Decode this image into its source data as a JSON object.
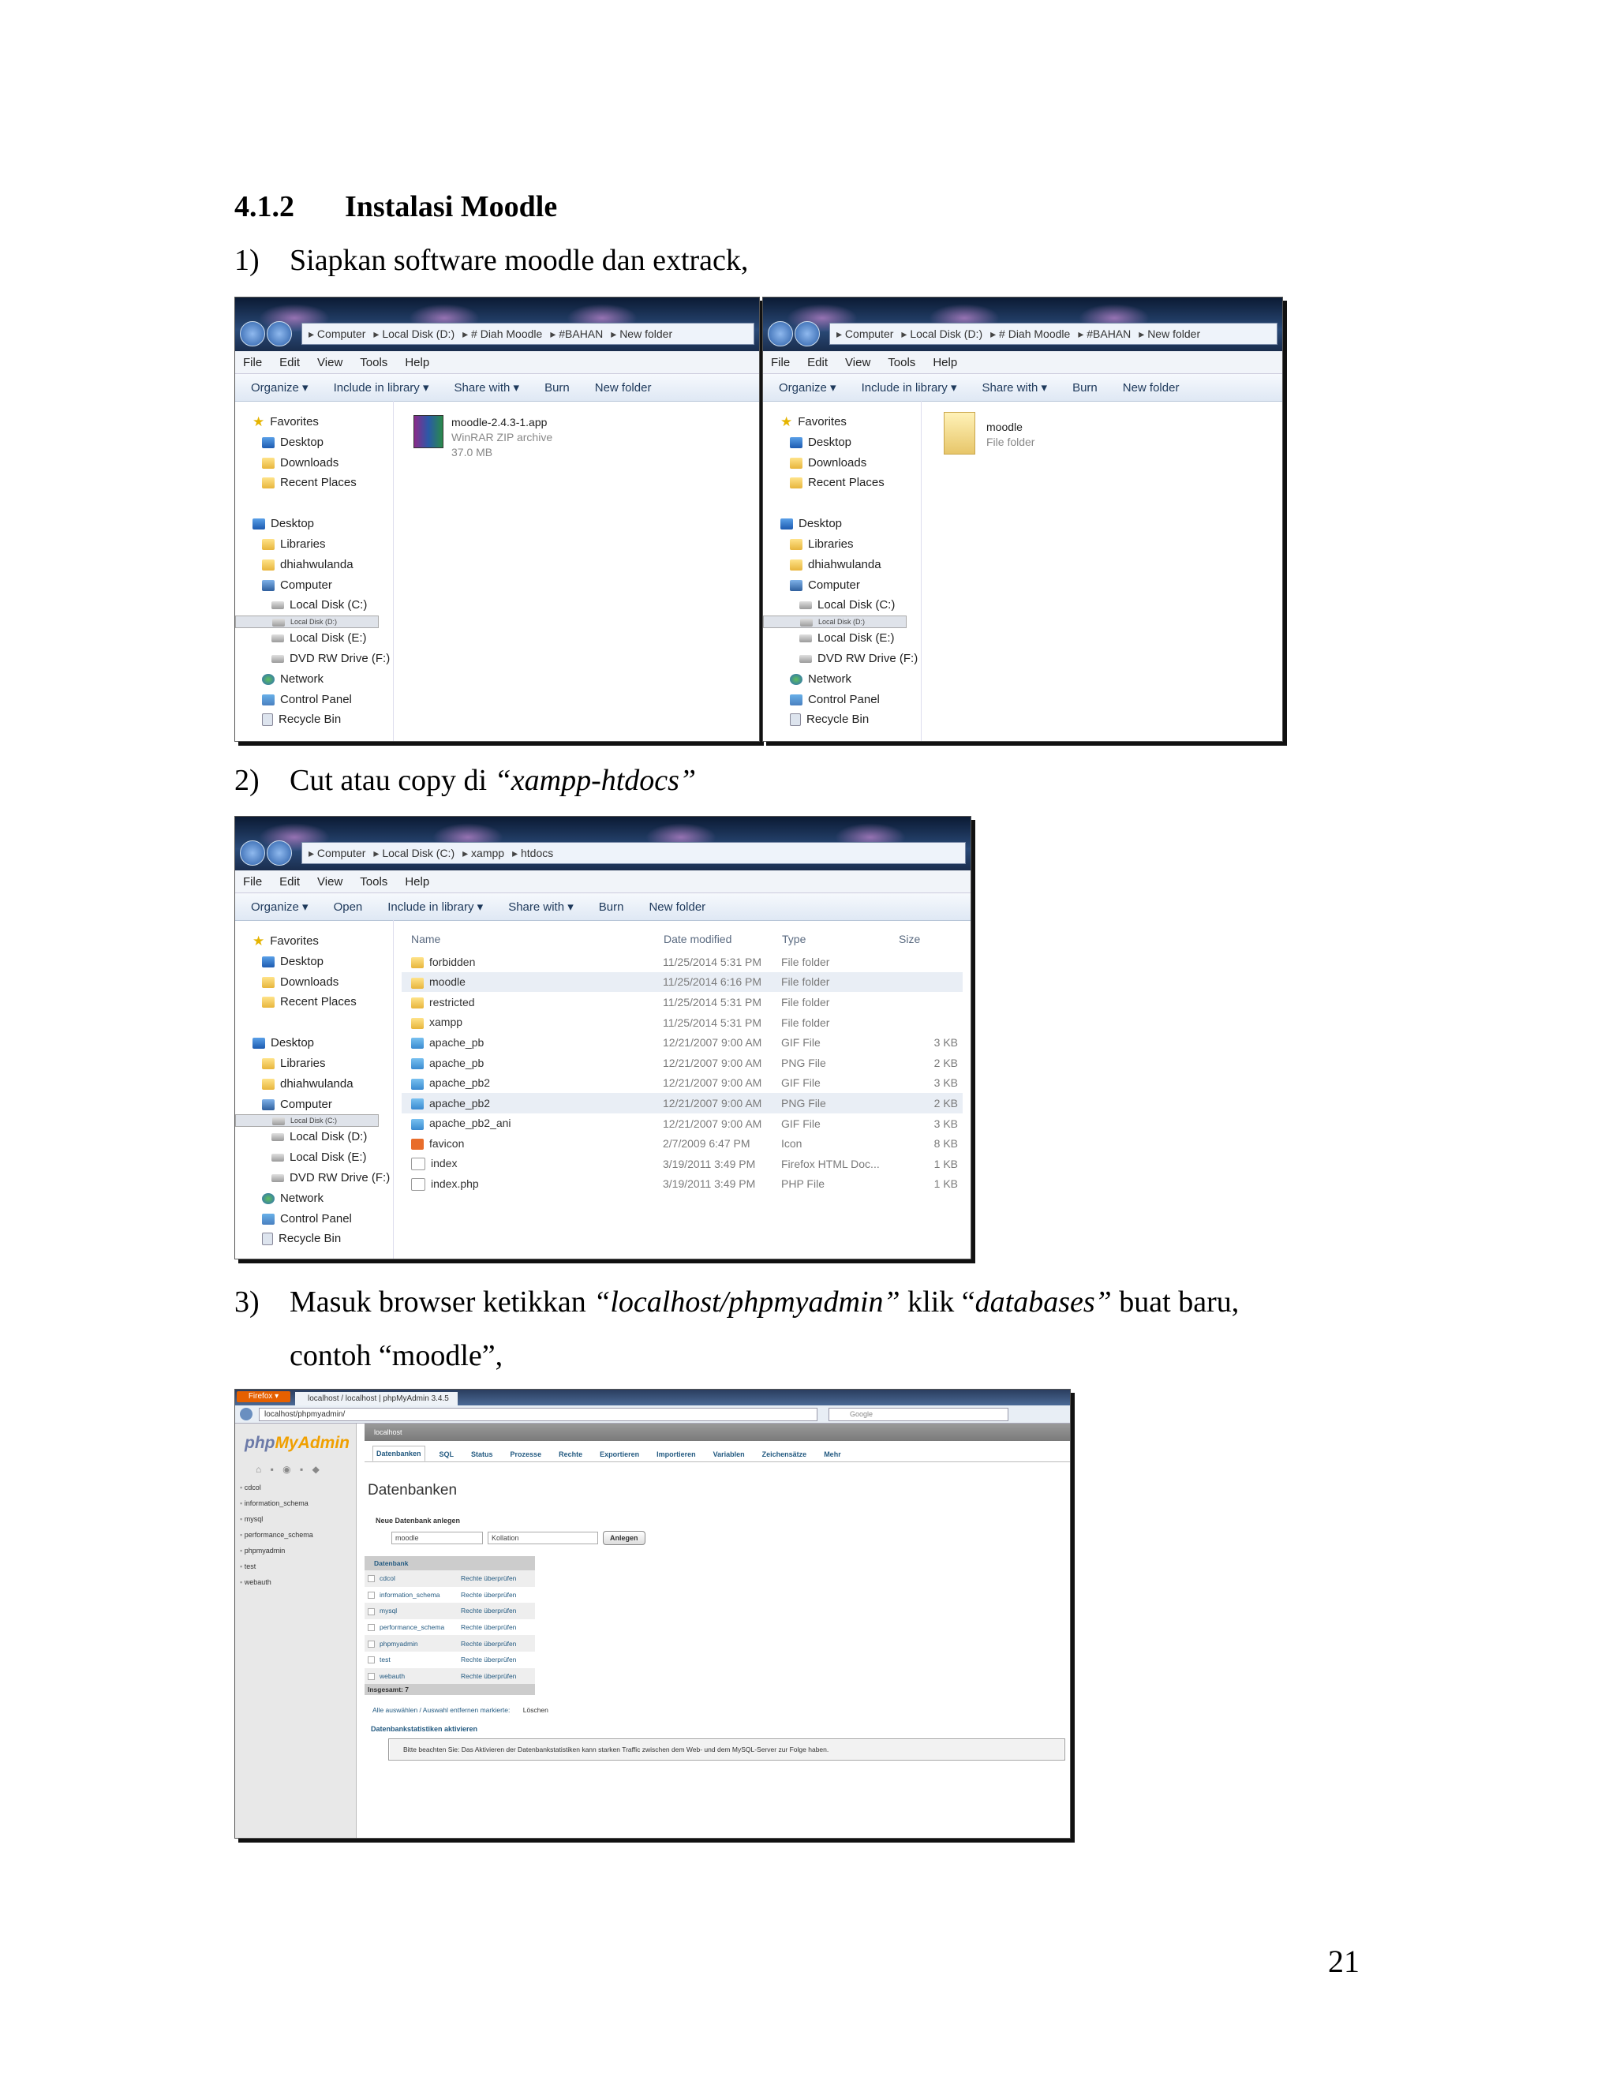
{
  "heading": {
    "number": "4.1.2",
    "title": "Instalasi Moodle"
  },
  "step1": {
    "num": "1)",
    "text": "Siapkan software moodle dan extrack,"
  },
  "step2": {
    "num": "2)",
    "text": "Cut atau copy di ",
    "italic": "“xampp-htdocs”"
  },
  "step3": {
    "num": "3)",
    "text_a": "Masuk browser ketikkan ",
    "italic_a": "“localhost/phpmyadmin”",
    "text_b": " klik “",
    "italic_b": "databases”",
    "text_c": " buat baru,",
    "line2": "contoh “moodle”,"
  },
  "page_number": "21",
  "explorer_common": {
    "menu": [
      "File",
      "Edit",
      "View",
      "Tools",
      "Help"
    ],
    "toolbar": [
      "Organize ▾",
      "Include in library ▾",
      "Share with ▾",
      "Burn",
      "New folder"
    ],
    "toolbar_htdocs": [
      "Organize ▾",
      "Open",
      "Include in library ▾",
      "Share with ▾",
      "Burn",
      "New folder"
    ],
    "tree": {
      "favorites": "Favorites",
      "desktop": "Desktop",
      "downloads": "Downloads",
      "recent": "Recent Places",
      "desktop2": "Desktop",
      "libraries": "Libraries",
      "user": "dhiahwulanda",
      "computer": "Computer",
      "c": "Local Disk (C:)",
      "d": "Local Disk (D:)",
      "e": "Local Disk (E:)",
      "f": "DVD RW Drive (F:)",
      "network": "Network",
      "control": "Control Panel",
      "recycle": "Recycle Bin"
    }
  },
  "win1": {
    "crumbs": [
      "Computer",
      "Local Disk (D:)",
      "# Diah Moodle",
      "#BAHAN",
      "New folder"
    ],
    "file": {
      "name": "moodle-2.4.3-1.app",
      "type": "WinRAR ZIP archive",
      "size": "37.0 MB"
    }
  },
  "win2": {
    "crumbs": [
      "Computer",
      "Local Disk (D:)",
      "# Diah Moodle",
      "#BAHAN",
      "New folder"
    ],
    "file": {
      "name": "moodle",
      "type": "File folder"
    }
  },
  "win3": {
    "crumbs": [
      "Computer",
      "Local Disk (C:)",
      "xampp",
      "htdocs"
    ],
    "columns": [
      "Name",
      "Date modified",
      "Type",
      "Size"
    ],
    "rows": [
      {
        "name": "forbidden",
        "date": "11/25/2014 5:31 PM",
        "type": "File folder",
        "size": "",
        "icon": "folder"
      },
      {
        "name": "moodle",
        "date": "11/25/2014 6:16 PM",
        "type": "File folder",
        "size": "",
        "icon": "folder"
      },
      {
        "name": "restricted",
        "date": "11/25/2014 5:31 PM",
        "type": "File folder",
        "size": "",
        "icon": "folder"
      },
      {
        "name": "xampp",
        "date": "11/25/2014 5:31 PM",
        "type": "File folder",
        "size": "",
        "icon": "folder"
      },
      {
        "name": "apache_pb",
        "date": "12/21/2007 9:00 AM",
        "type": "GIF File",
        "size": "3 KB",
        "icon": "gif"
      },
      {
        "name": "apache_pb",
        "date": "12/21/2007 9:00 AM",
        "type": "PNG File",
        "size": "2 KB",
        "icon": "gif"
      },
      {
        "name": "apache_pb2",
        "date": "12/21/2007 9:00 AM",
        "type": "GIF File",
        "size": "3 KB",
        "icon": "gif"
      },
      {
        "name": "apache_pb2",
        "date": "12/21/2007 9:00 AM",
        "type": "PNG File",
        "size": "2 KB",
        "icon": "gif"
      },
      {
        "name": "apache_pb2_ani",
        "date": "12/21/2007 9:00 AM",
        "type": "GIF File",
        "size": "3 KB",
        "icon": "gif"
      },
      {
        "name": "favicon",
        "date": "2/7/2009 6:47 PM",
        "type": "Icon",
        "size": "8 KB",
        "icon": "xml"
      },
      {
        "name": "index",
        "date": "3/19/2011 3:49 PM",
        "type": "Firefox HTML Doc...",
        "size": "1 KB",
        "icon": "html"
      },
      {
        "name": "index.php",
        "date": "3/19/2011 3:49 PM",
        "type": "PHP File",
        "size": "1 KB",
        "icon": "html"
      }
    ]
  },
  "browser": {
    "app_button": "Firefox ▾",
    "tab_title": "localhost / localhost | phpMyAdmin 3.4.5",
    "url": "localhost/phpmyadmin/",
    "search_placeholder": "Google",
    "logo_php": "php",
    "logo_myadmin": "MyAdmin",
    "sidebar_dbs": [
      "cdcol",
      "information_schema",
      "mysql",
      "performance_schema",
      "phpmyadmin",
      "test",
      "webauth"
    ],
    "server": "localhost",
    "tabs": [
      "Datenbanken",
      "SQL",
      "Status",
      "Prozesse",
      "Rechte",
      "Exportieren",
      "Importieren",
      "Variablen",
      "Zeichensätze",
      "Mehr"
    ],
    "page_title": "Datenbanken",
    "new_db_label": "Neue Datenbank anlegen",
    "new_db_value": "moodle",
    "collation_placeholder": "Kollation",
    "create_button": "Anlegen",
    "table_header": "Datenbank",
    "check_privs": "Rechte überprüfen",
    "total": "Insgesamt: 7",
    "select_all": "Alle auswählen / Auswahl entfernen",
    "marked": "markierte:",
    "delete": "Löschen",
    "enable_stats": "Datenbankstatistiken aktivieren",
    "notice": "Bitte beachten Sie: Das Aktivieren der Datenbankstatistiken kann starken Traffic zwischen dem Web- und dem MySQL-Server zur Folge haben."
  }
}
